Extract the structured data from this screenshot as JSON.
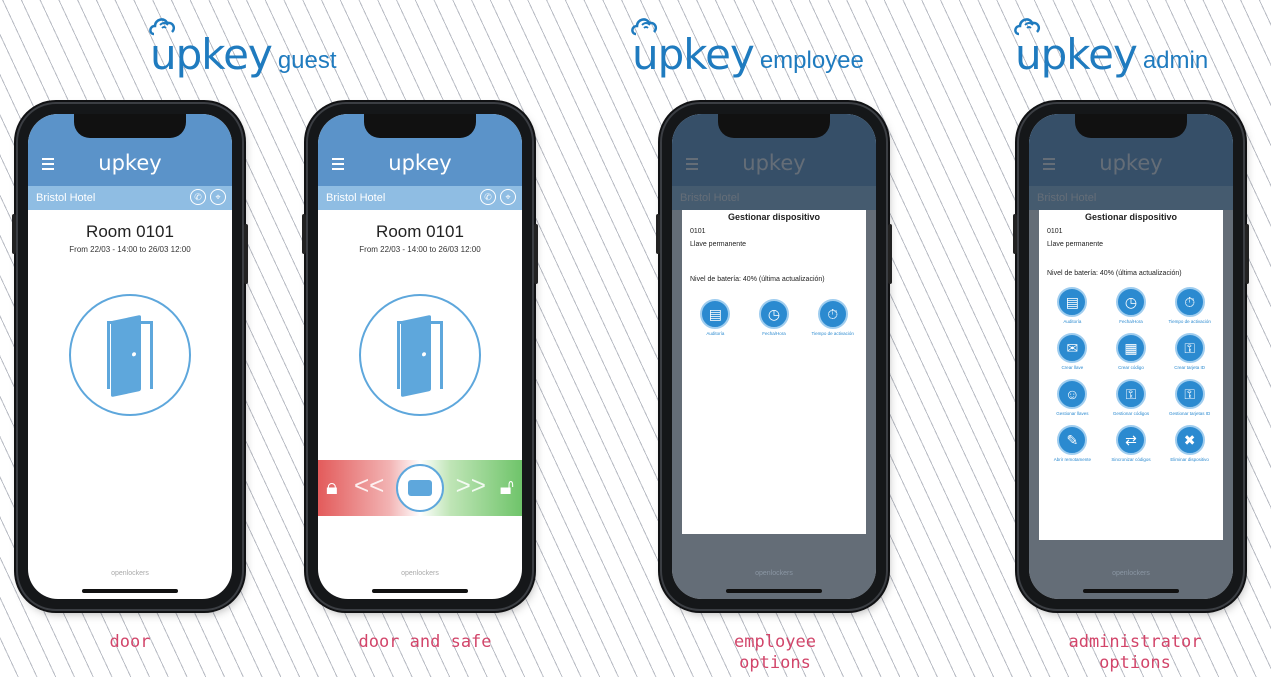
{
  "brands": [
    {
      "word": "upkey",
      "sub": "guest"
    },
    {
      "word": "upkey",
      "sub": "employee"
    },
    {
      "word": "upkey",
      "sub": "admin"
    }
  ],
  "app": {
    "logo": "upkey",
    "hotel": "Bristol Hotel",
    "room": "Room 0101",
    "dates": "From 22/03 - 14:00 to 26/03 12:00",
    "footer": "openlockers"
  },
  "modal": {
    "title": "Gestionar dispositivo",
    "device": "0101",
    "key_type": "Llave permanente",
    "battery": "Nivel de batería: 40% (última actualización)"
  },
  "employee_options": [
    {
      "icon": "document-icon",
      "label": "Auditoría"
    },
    {
      "icon": "clock-icon",
      "label": "Fecha/Hora"
    },
    {
      "icon": "stopwatch-icon",
      "label": "Tiempo de activación"
    }
  ],
  "admin_options": [
    {
      "icon": "document-icon",
      "label": "Auditoría"
    },
    {
      "icon": "clock-icon",
      "label": "Fecha/Hora"
    },
    {
      "icon": "stopwatch-icon",
      "label": "Tiempo de activación"
    },
    {
      "icon": "mail-key-icon",
      "label": "Crear llave"
    },
    {
      "icon": "pin-code-icon",
      "label": "Crear código"
    },
    {
      "icon": "key-id-icon",
      "label": "Crear tarjeta ID"
    },
    {
      "icon": "user-icon",
      "label": "Gestionar llaves"
    },
    {
      "icon": "code-manage-icon",
      "label": "Gestionar códigos"
    },
    {
      "icon": "card-manage-icon",
      "label": "Gestionar tarjetas ID"
    },
    {
      "icon": "wrench-icon",
      "label": "Abrir remotamente"
    },
    {
      "icon": "sync-icon",
      "label": "Sincronizar códigos"
    },
    {
      "icon": "delete-device-icon",
      "label": "Eliminar dispositivo"
    }
  ],
  "captions": [
    "door",
    "door and safe",
    "employee\noptions",
    "administrator\noptions"
  ],
  "colors": {
    "brand": "#1f7bbf",
    "appbar": "#5b93c9",
    "caption": "#d2456a",
    "icon": "#2b8ad0"
  }
}
